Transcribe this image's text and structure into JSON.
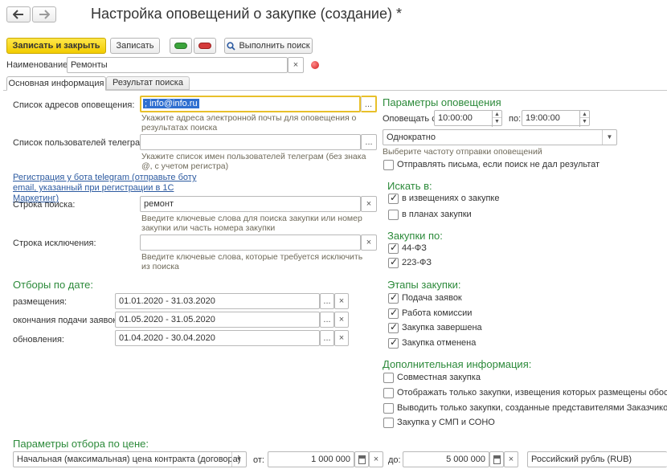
{
  "header": {
    "title": "Настройка оповещений о закупке (создание) *",
    "back_icon": "arrow-left-icon",
    "forward_icon": "arrow-right-icon"
  },
  "toolbar": {
    "save_close_label": "Записать и закрыть",
    "save_label": "Записать",
    "run_search_label": "Выполнить поиск"
  },
  "name_field": {
    "label": "Наименование:",
    "value": "Ремонты",
    "clear": "×"
  },
  "tabs": [
    {
      "label": "Основная информация",
      "active": true
    },
    {
      "label": "Результат поиска",
      "active": false
    }
  ],
  "left": {
    "emails": {
      "label": "Список адресов оповещения:",
      "value": "; info@info.ru",
      "hint": "Укажите адреса электронной почты для оповещения о результатах поиска"
    },
    "telegram": {
      "label": "Список пользователей телеграм:",
      "value": "",
      "hint": "Укажите список имен пользователей телеграм (без знака @, с учетом регистра)"
    },
    "telegram_link": "Регистрация у бота telegram (отправьте боту email, указанный при регистрации в 1С Маркетинг)",
    "search": {
      "label": "Строка поиска:",
      "value": "ремонт",
      "hint": "Введите ключевые слова для поиска закупки или номер закупки или часть номера закупки"
    },
    "exclude": {
      "label": "Строка исключения:",
      "value": "",
      "hint": "Введите ключевые слова, которые требуется исключить из поиска"
    },
    "date_filters": {
      "title": "Отборы по дате:",
      "rows": [
        {
          "label": "размещения:",
          "value": "01.01.2020 - 31.03.2020"
        },
        {
          "label": "окончания подачи заявок:",
          "value": "01.05.2020 - 31.05.2020"
        },
        {
          "label": "обновления:",
          "value": "01.04.2020 - 30.04.2020"
        }
      ]
    }
  },
  "right": {
    "notify_title": "Параметры оповещения",
    "notify_from_label": "Оповещать с:",
    "notify_from": "10:00:00",
    "notify_to_label": "по:",
    "notify_to": "19:00:00",
    "frequency": "Однократно",
    "frequency_hint": "Выберите частоту отправки оповещений",
    "send_empty": {
      "label": "Отправлять письма, если поиск не дал результат",
      "checked": false
    },
    "search_in": {
      "title": "Искать в:",
      "items": [
        {
          "label": "в извещениях о закупке",
          "checked": true
        },
        {
          "label": "в планах закупки",
          "checked": false
        }
      ]
    },
    "laws": {
      "title": "Закупки по:",
      "items": [
        {
          "label": "44-ФЗ",
          "checked": true
        },
        {
          "label": "223-ФЗ",
          "checked": true
        }
      ]
    },
    "stages": {
      "title": "Этапы закупки:",
      "items": [
        {
          "label": "Подача заявок",
          "checked": true
        },
        {
          "label": "Работа комиссии",
          "checked": true
        },
        {
          "label": "Закупка завершена",
          "checked": true
        },
        {
          "label": "Закупка отменена",
          "checked": true
        }
      ]
    },
    "extra": {
      "title": "Дополнительная информация:",
      "items": [
        {
          "label": "Совместная закупка",
          "checked": false
        },
        {
          "label": "Отображать только закупки, извещения которых размещены обособлен",
          "checked": false
        },
        {
          "label": "Выводить только закупки, созданные представителями Заказчиков",
          "checked": false
        },
        {
          "label": "Закупка у СМП и СОНО",
          "checked": false
        }
      ]
    }
  },
  "price": {
    "title": "Параметры отбора по цене:",
    "type": "Начальная (максимальная) цена контракта (договора)",
    "from_label": "от:",
    "from_value": "1 000 000",
    "to_label": "до:",
    "to_value": "5 000 000",
    "currency": "Российский рубль (RUB)"
  },
  "glyphs": {
    "dots": "...",
    "clear": "×",
    "check": "✓",
    "caret": "▼",
    "up": "▲",
    "down": "▼"
  },
  "colors": {
    "accent_button": "#f5d400",
    "section_title": "#2c8a3a",
    "link": "#2c5aa0",
    "focus": "#e8c02a"
  }
}
